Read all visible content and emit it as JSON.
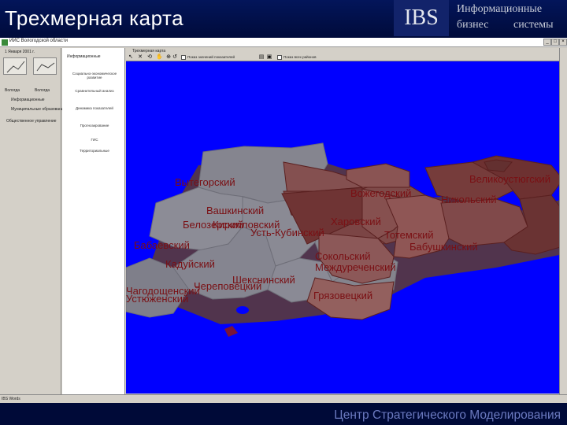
{
  "slide": {
    "title": "Трехмерная карта",
    "logo": "IBS",
    "tagline_1": "Информационные",
    "tagline_2": "бизнес",
    "tagline_3": "системы",
    "footer": "Центр Стратегического Моделирования"
  },
  "window": {
    "title": "ИИС Вологодской области",
    "controls": [
      "_",
      "□",
      "×"
    ]
  },
  "left_panel": {
    "period": "1 Января 2001 г.",
    "items": [
      "Вологда",
      "Вологда",
      "Информационные",
      "Муниципальные образования",
      "Общественное управление"
    ]
  },
  "mid_panel": {
    "header": "Информационные",
    "items": [
      "Социально-экономическое развитие",
      "Сравнительный анализ",
      "Динамика показателей",
      "Прогнозирование",
      "ГИС",
      "Территориальные"
    ]
  },
  "map_toolbar": {
    "caption": "Трехмерная карта",
    "checkbox_1": "Показ значений показателей",
    "checkbox_2": "Показ всех районов"
  },
  "status": "IBS Words",
  "map": {
    "background": "#0000ff",
    "regions": [
      "Вытегорский",
      "Бабаевский",
      "Кадуйский",
      "Шекснинский",
      "Череповецкий",
      "Устюженский",
      "Чагодощенский",
      "Белозерский",
      "Вашкинский",
      "Кирилловский",
      "Усть-Кубинский",
      "Вожегодский",
      "Сокольский",
      "Междуреченский",
      "Грязовецкий",
      "Тотемский",
      "Бабушкинский",
      "Никольский",
      "Великоустюгский",
      "Харовский"
    ]
  }
}
